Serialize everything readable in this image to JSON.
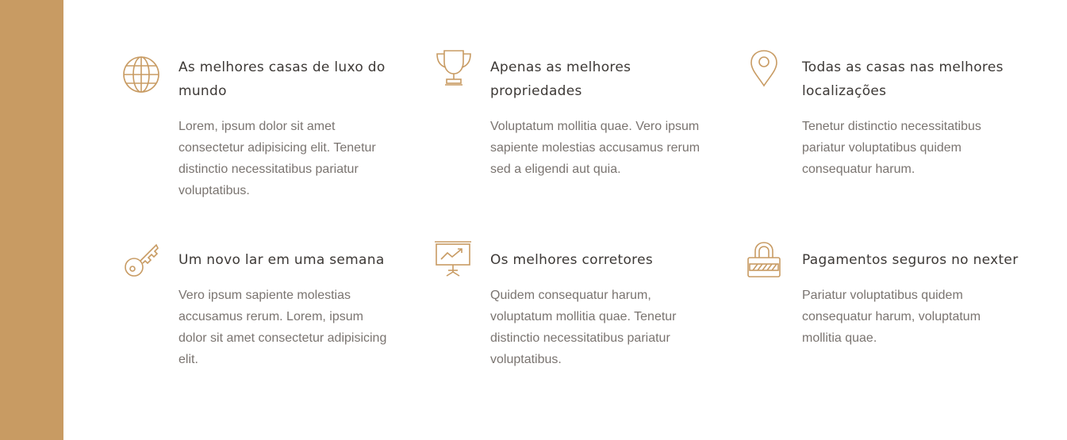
{
  "theme": {
    "accent": "#c89b63",
    "heading_color": "#3d3936",
    "body_color": "#7a7470"
  },
  "features": [
    {
      "icon": "globe-icon",
      "title": "As melhores casas de luxo do mundo",
      "description": "Lorem, ipsum dolor sit amet consectetur adipisicing elit. Tenetur distinctio necessitatibus pariatur voluptatibus."
    },
    {
      "icon": "trophy-icon",
      "title": "Apenas as melhores propriedades",
      "description": "Voluptatum mollitia quae. Vero ipsum sapiente molestias accusamus rerum sed a eligendi aut quia."
    },
    {
      "icon": "map-pin-icon",
      "title": "Todas as casas nas melhores localizações",
      "description": "Tenetur distinctio necessitatibus pariatur voluptatibus quidem consequatur harum."
    },
    {
      "icon": "key-icon",
      "title": "Um novo lar em uma semana",
      "description": "Vero ipsum sapiente molestias accusamus rerum. Lorem, ipsum dolor sit amet consectetur adipisicing elit."
    },
    {
      "icon": "presentation-chart-icon",
      "title": "Os melhores corretores",
      "description": "Quidem consequatur harum, voluptatum mollitia quae. Tenetur distinctio necessitatibus pariatur voluptatibus."
    },
    {
      "icon": "lock-icon",
      "title": "Pagamentos seguros no nexter",
      "description": "Pariatur voluptatibus quidem consequatur harum, voluptatum mollitia quae."
    }
  ]
}
